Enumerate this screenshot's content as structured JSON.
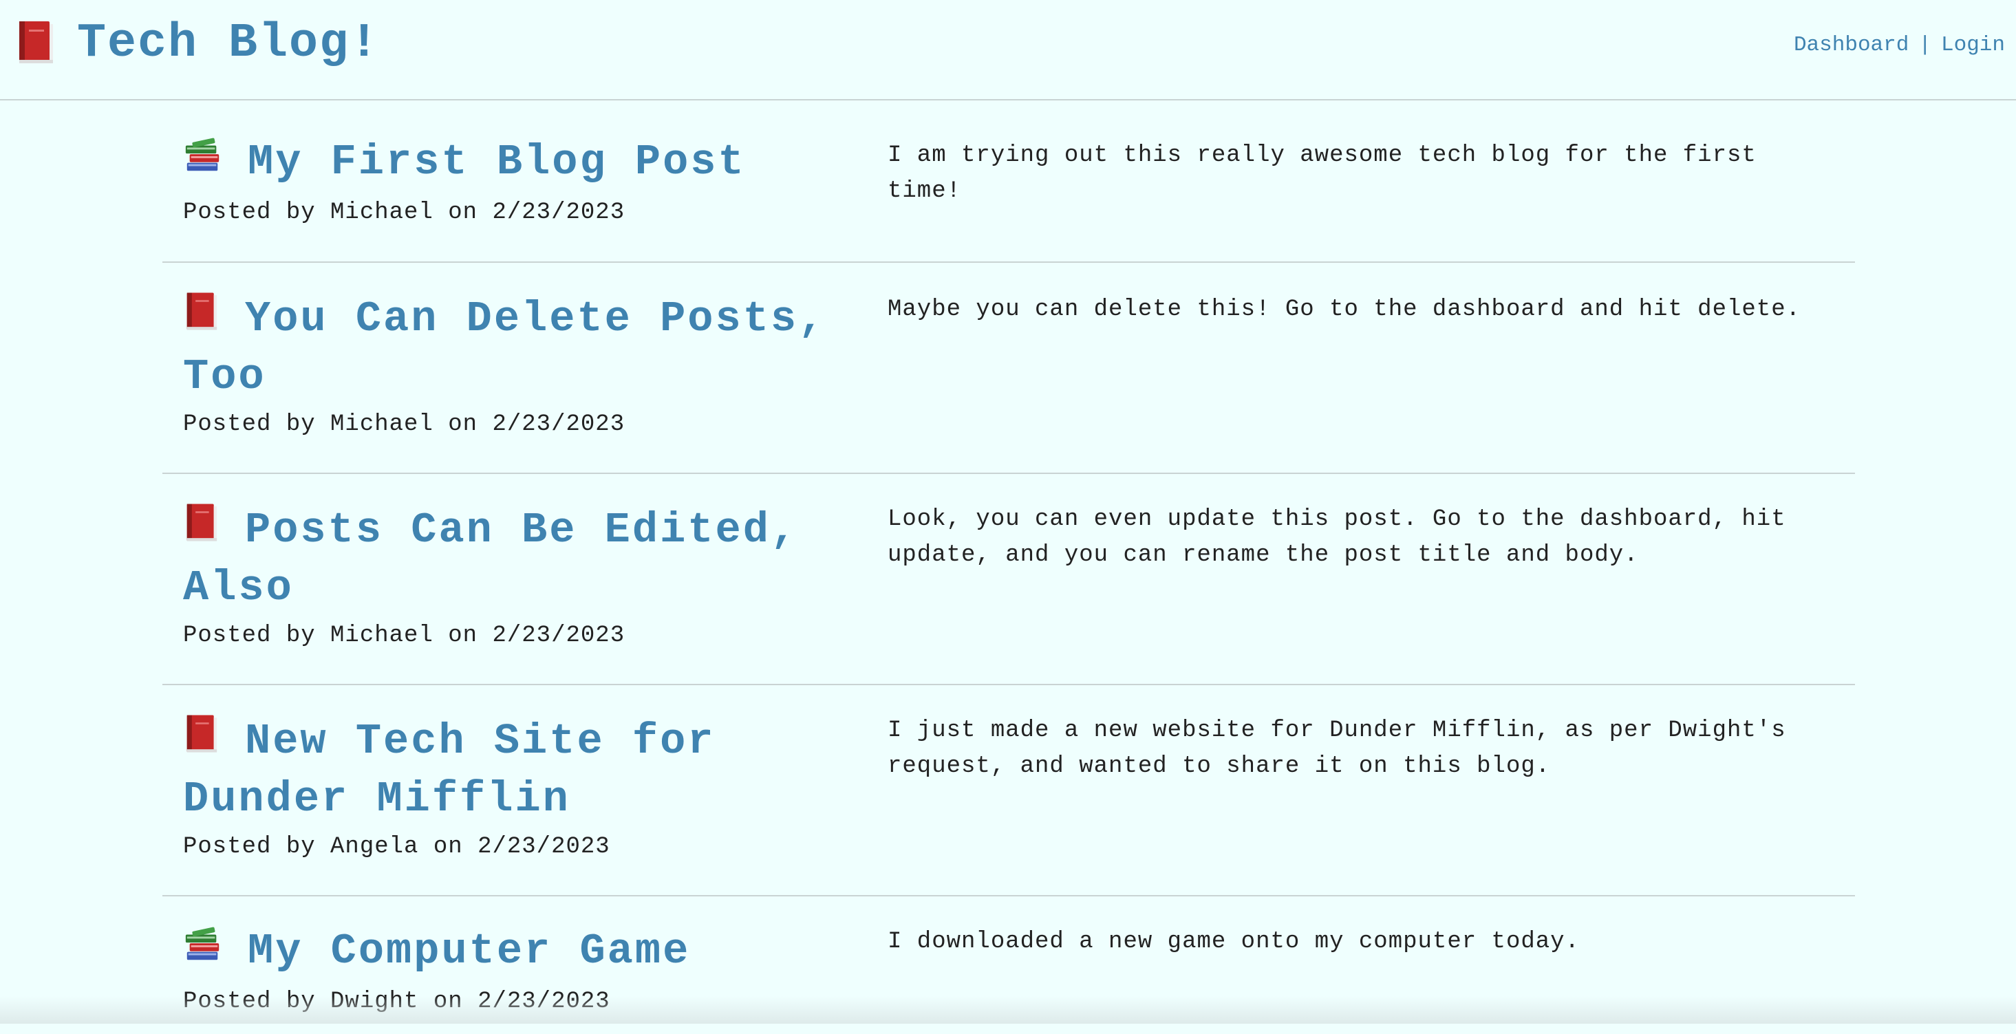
{
  "header": {
    "title": "Tech Blog!",
    "logo_icon": "red-book-icon",
    "nav": {
      "dashboard": "Dashboard",
      "separator": "|",
      "login": "Login"
    }
  },
  "colors": {
    "background": "#effffe",
    "accent": "#3f83b0",
    "divider": "#c9d3d3"
  },
  "posts": [
    {
      "icon": "stacked-books-icon",
      "title": "My First Blog Post",
      "byline": "Posted by Michael on 2/23/2023",
      "body": "I am trying out this really awesome tech blog for the first time!"
    },
    {
      "icon": "red-book-icon",
      "title": "You Can Delete Posts, Too",
      "byline": "Posted by Michael on 2/23/2023",
      "body": "Maybe you can delete this! Go to the dashboard and hit delete."
    },
    {
      "icon": "red-book-icon",
      "title": "Posts Can Be Edited, Also",
      "byline": "Posted by Michael on 2/23/2023",
      "body": "Look, you can even update this post. Go to the dashboard, hit update, and you can rename the post title and body."
    },
    {
      "icon": "red-book-icon",
      "title": "New Tech Site for Dunder Mifflin",
      "byline": "Posted by Angela on 2/23/2023",
      "body": "I just made a new website for Dunder Mifflin, as per Dwight's request, and wanted to share it on this blog."
    },
    {
      "icon": "stacked-books-icon",
      "title": "My Computer Game",
      "byline": "Posted by Dwight on 2/23/2023",
      "body": "I downloaded a new game onto my computer today."
    }
  ]
}
